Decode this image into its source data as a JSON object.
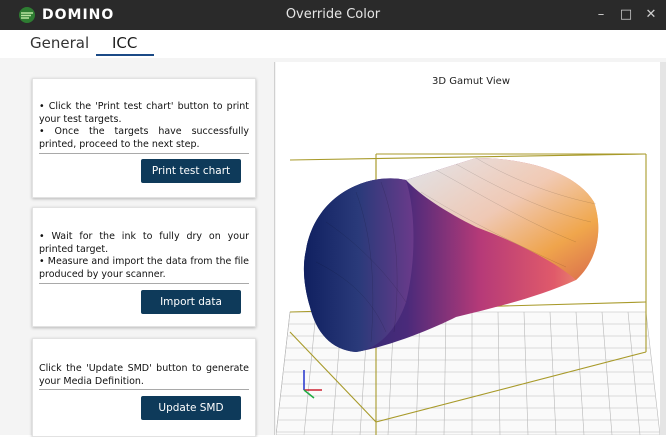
{
  "window": {
    "brand": "DOMINO",
    "title": "Override Color",
    "minimize_icon": "minimize-icon",
    "maximize_icon": "maximize-icon",
    "close_icon": "close-icon"
  },
  "tabs": [
    {
      "label": "General",
      "active": false
    },
    {
      "label": "ICC",
      "active": true
    }
  ],
  "steps": [
    {
      "lines": [
        "• Click the 'Print test chart' button to print your test targets.",
        "• Once the targets have successfully printed, proceed to the next step."
      ],
      "button": "Print test chart"
    },
    {
      "lines": [
        "• Wait for the ink to fully dry on your printed target.",
        "• Measure and import the data from the file produced by your scanner."
      ],
      "button": "Import data"
    },
    {
      "lines": [
        "Click the 'Update SMD' button to generate your Media Definition."
      ],
      "button": "Update SMD"
    }
  ],
  "gamut": {
    "title": "3D Gamut View"
  },
  "colors": {
    "titlebar": "#2a2a2a",
    "button": "#0e3a5a",
    "tab_underline": "#1b4a86",
    "brand_green": "#4caf50"
  }
}
